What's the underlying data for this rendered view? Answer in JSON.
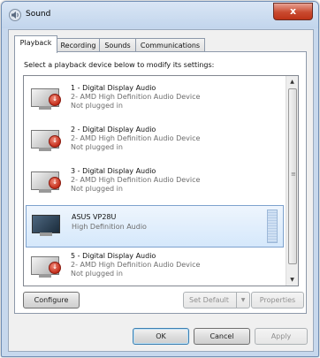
{
  "window": {
    "title": "Sound",
    "close_label": "x"
  },
  "tabs": [
    "Playback",
    "Recording",
    "Sounds",
    "Communications"
  ],
  "instruction": "Select a playback device below to modify its settings:",
  "devices": [
    {
      "name": "1 - Digital Display Audio",
      "desc": "2- AMD High Definition Audio Device",
      "status": "Not plugged in"
    },
    {
      "name": "2 - Digital Display Audio",
      "desc": "2- AMD High Definition Audio Device",
      "status": "Not plugged in"
    },
    {
      "name": "3 - Digital Display Audio",
      "desc": "2- AMD High Definition Audio Device",
      "status": "Not plugged in"
    },
    {
      "name": "ASUS VP28U",
      "desc": "High Definition Audio",
      "status": ""
    },
    {
      "name": "5 - Digital Display Audio",
      "desc": "2- AMD High Definition Audio Device",
      "status": "Not plugged in"
    }
  ],
  "buttons": {
    "configure": "Configure",
    "set_default": "Set Default",
    "properties": "Properties",
    "ok": "OK",
    "cancel": "Cancel",
    "apply": "Apply"
  },
  "colors": {
    "selection": "#d5e8fb",
    "close": "#c94a2f"
  }
}
